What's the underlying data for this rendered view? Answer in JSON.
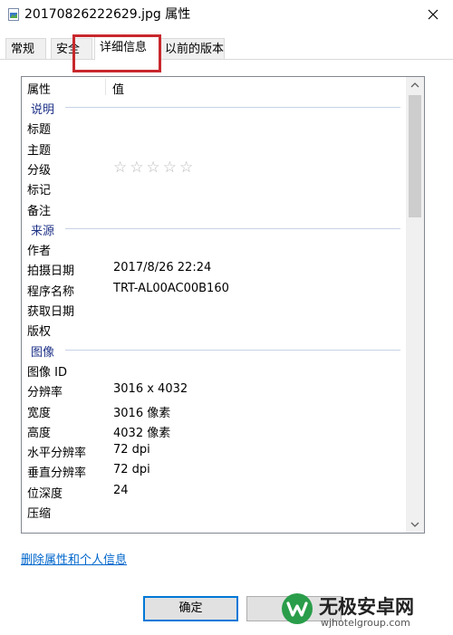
{
  "window": {
    "title": "20170826222629.jpg 属性",
    "title_icon": "image-file-icon",
    "close_icon": "close-icon"
  },
  "tabs": [
    {
      "label": "常规",
      "active": false
    },
    {
      "label": "安全",
      "active": false
    },
    {
      "label": "详细信息",
      "active": true
    },
    {
      "label": "以前的版本",
      "active": false
    }
  ],
  "colors": {
    "highlight": "#c8282d",
    "group_header": "#1e3287",
    "link": "#0066cc",
    "default_button_border": "#0078d7"
  },
  "list": {
    "headers": {
      "property": "属性",
      "value": "值"
    },
    "groups": [
      {
        "name": "说明",
        "rows": [
          {
            "k": "标题",
            "v": ""
          },
          {
            "k": "主题",
            "v": ""
          },
          {
            "k": "分级",
            "v": "",
            "stars": 5
          },
          {
            "k": "标记",
            "v": ""
          },
          {
            "k": "备注",
            "v": ""
          }
        ]
      },
      {
        "name": "来源",
        "rows": [
          {
            "k": "作者",
            "v": ""
          },
          {
            "k": "拍摄日期",
            "v": "2017/8/26 22:24"
          },
          {
            "k": "程序名称",
            "v": "TRT-AL00AC00B160"
          },
          {
            "k": "获取日期",
            "v": ""
          },
          {
            "k": "版权",
            "v": ""
          }
        ]
      },
      {
        "name": "图像",
        "rows": [
          {
            "k": "图像 ID",
            "v": ""
          },
          {
            "k": "分辨率",
            "v": "3016 x 4032"
          },
          {
            "k": "宽度",
            "v": "3016 像素"
          },
          {
            "k": "高度",
            "v": "4032 像素"
          },
          {
            "k": "水平分辨率",
            "v": "72 dpi"
          },
          {
            "k": "垂直分辨率",
            "v": "72 dpi"
          },
          {
            "k": "位深度",
            "v": "24"
          },
          {
            "k": "压缩",
            "v": ""
          }
        ]
      }
    ],
    "rating_icon": "star-outline-icon",
    "scroll_up_icon": "chevron-up-icon",
    "scroll_down_icon": "chevron-down-icon"
  },
  "footer": {
    "remove_link": "删除属性和个人信息",
    "ok_label": "确定"
  },
  "watermark": {
    "name": "无极安卓网",
    "url": "wjhotelgroup.com"
  }
}
